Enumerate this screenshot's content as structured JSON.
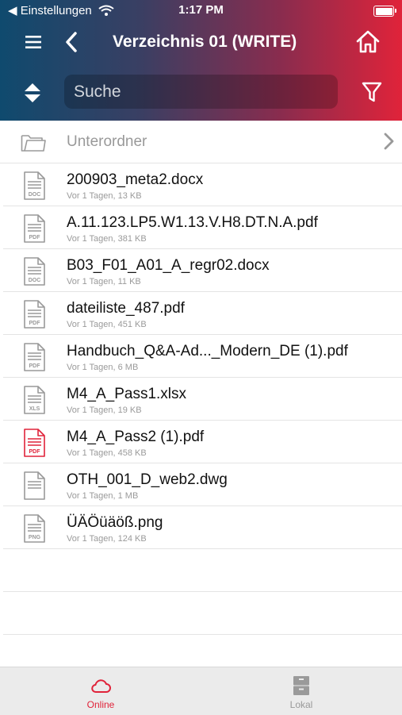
{
  "status_bar": {
    "back_label": "◀ Einstellungen",
    "time": "1:17 PM"
  },
  "navbar": {
    "title": "Verzeichnis 01 (WRITE)"
  },
  "search": {
    "placeholder": "Suche"
  },
  "folder": {
    "label": "Unterordner"
  },
  "files": [
    {
      "name": "200903_meta2.docx",
      "meta": "Vor 1 Tagen, 13 KB",
      "type": "DOC"
    },
    {
      "name": "A.11.123.LP5.W1.13.V.H8.DT.N.A.pdf",
      "meta": "Vor 1 Tagen, 381 KB",
      "type": "PDF"
    },
    {
      "name": "B03_F01_A01_A_regr02.docx",
      "meta": "Vor 1 Tagen, 11 KB",
      "type": "DOC"
    },
    {
      "name": "dateiliste_487.pdf",
      "meta": "Vor 1 Tagen, 451 KB",
      "type": "PDF"
    },
    {
      "name": "Handbuch_Q&A-Ad..._Modern_DE (1).pdf",
      "meta": "Vor 1 Tagen, 6 MB",
      "type": "PDF"
    },
    {
      "name": "M4_A_Pass1.xlsx",
      "meta": "Vor 1 Tagen, 19 KB",
      "type": "XLS"
    },
    {
      "name": "M4_A_Pass2 (1).pdf",
      "meta": "Vor 1 Tagen, 458 KB",
      "type": "PDF"
    },
    {
      "name": "OTH_001_D_web2.dwg",
      "meta": "Vor 1 Tagen, 1 MB",
      "type": ""
    },
    {
      "name": "ÜÄÖüäöß.png",
      "meta": "Vor 1 Tagen, 124 KB",
      "type": "PNG"
    }
  ],
  "tabs": {
    "online": "Online",
    "lokal": "Lokal"
  },
  "colors": {
    "accent": "#e0233a",
    "gradient_start": "#0f4a6e",
    "gradient_end": "#e0233a",
    "inactive": "#999999"
  }
}
